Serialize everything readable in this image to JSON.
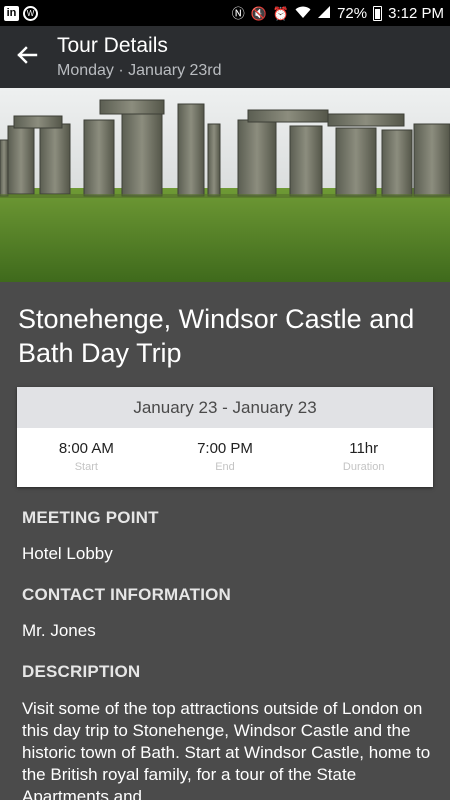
{
  "status_bar": {
    "battery": "72%",
    "time": "3:12 PM",
    "icons": [
      "linkedin-icon",
      "wordpress-icon",
      "nfc-icon",
      "mute-icon",
      "alarm-icon",
      "wifi-icon",
      "signal-icon",
      "battery-icon"
    ]
  },
  "app_bar": {
    "title": "Tour Details",
    "subtitle": "Monday · January 23rd",
    "background": "#2b2d30"
  },
  "tour": {
    "title": "Stonehenge, Windsor Castle and Bath Day Trip",
    "date_range": "January 23 - January 23",
    "start": {
      "value": "8:00 AM",
      "label": "Start"
    },
    "end": {
      "value": "7:00 PM",
      "label": "End"
    },
    "duration": {
      "value": "11hr",
      "label": "Duration"
    }
  },
  "sections": {
    "meeting_point": {
      "heading": "MEETING POINT",
      "text": "Hotel Lobby"
    },
    "contact": {
      "heading": "CONTACT INFORMATION",
      "text": "Mr. Jones"
    },
    "description": {
      "heading": "DESCRIPTION",
      "text": "Visit some of the top attractions outside of London on this day trip to Stonehenge, Windsor Castle and the historic town of Bath. Start at Windsor Castle, home to the British royal family, for a tour of the State Apartments and"
    }
  },
  "colors": {
    "page_bg": "#4b4b4b",
    "card_header": "#e1e2e5"
  }
}
